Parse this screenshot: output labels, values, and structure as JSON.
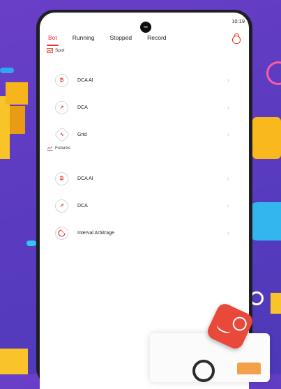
{
  "status_bar": {
    "time": "10:19"
  },
  "tabs": [
    {
      "label": "Bot",
      "active": true
    },
    {
      "label": "Running",
      "active": false
    },
    {
      "label": "Stopped",
      "active": false
    },
    {
      "label": "Record",
      "active": false
    }
  ],
  "header_icon": "wallet-icon",
  "sections": {
    "spot": {
      "title": "Spot",
      "items": [
        {
          "label": "DCA AI",
          "icon": "bitcoin-icon"
        },
        {
          "label": "DCA",
          "icon": "arrow-up-right-icon"
        },
        {
          "label": "Grid",
          "icon": "grid-wave-icon"
        }
      ]
    },
    "futures": {
      "title": "Futures",
      "items": [
        {
          "label": "DCA AI",
          "icon": "bitcoin-icon"
        },
        {
          "label": "DCA",
          "icon": "arrow-up-right-icon"
        },
        {
          "label": "Interval Arbitrage",
          "icon": "interval-arbitrage-icon"
        }
      ]
    }
  },
  "colors": {
    "accent": "#e8332a",
    "background_purple": "#5b3bc0"
  }
}
